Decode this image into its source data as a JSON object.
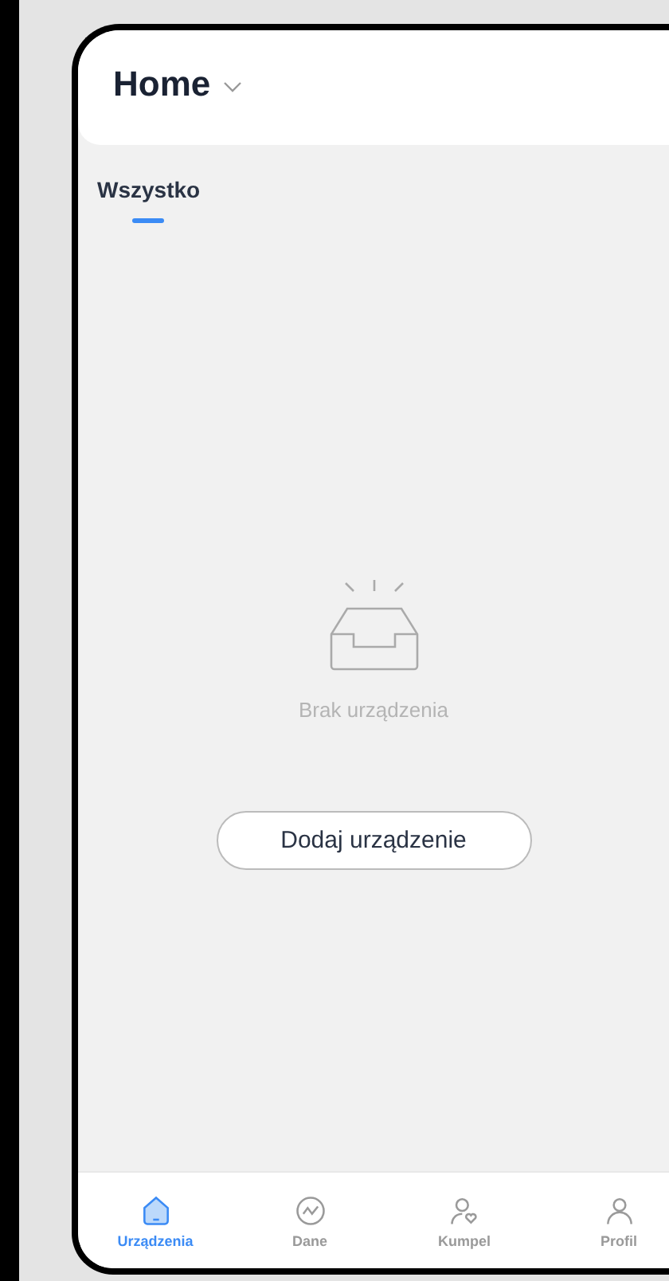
{
  "header": {
    "title": "Home"
  },
  "tabs": [
    {
      "label": "Wszystko",
      "selected": true
    }
  ],
  "empty_state": {
    "message": "Brak urządzenia",
    "button": "Dodaj urządzenie"
  },
  "bottom_nav": [
    {
      "kind": "devices",
      "label": "Urządzenia",
      "selected": true
    },
    {
      "kind": "data",
      "label": "Dane",
      "selected": false
    },
    {
      "kind": "buddy",
      "label": "Kumpel",
      "selected": false
    },
    {
      "kind": "profile",
      "label": "Profil",
      "selected": false
    }
  ]
}
